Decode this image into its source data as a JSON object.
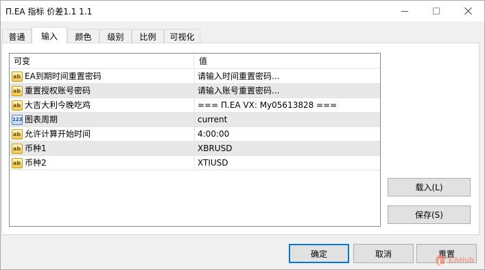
{
  "window": {
    "title": "П.EA 指标 价差1.1 1.1"
  },
  "tabs": [
    {
      "label": "普通",
      "active": false
    },
    {
      "label": "输入",
      "active": true
    },
    {
      "label": "颜色",
      "active": false
    },
    {
      "label": "级别",
      "active": false
    },
    {
      "label": "比例",
      "active": false
    },
    {
      "label": "可视化",
      "active": false
    }
  ],
  "grid": {
    "headers": {
      "variable": "可变",
      "value": "值"
    },
    "rows": [
      {
        "icon": "string-icon",
        "icon_text": "ab",
        "name": "EA到期时间重置密码",
        "value": "请输入时间重置密码..."
      },
      {
        "icon": "string-icon",
        "icon_text": "ab",
        "name": "重置授权账号密码",
        "value": "请输入账号重置密码..."
      },
      {
        "icon": "string-icon",
        "icon_text": "ab",
        "name": "大吉大利今晚吃鸡",
        "value": "=== П.EA VX:  My05613828 ==="
      },
      {
        "icon": "number-icon",
        "icon_text": "123",
        "name": "图表周期",
        "value": "current"
      },
      {
        "icon": "string-icon",
        "icon_text": "ab",
        "name": "允许计算开始时间",
        "value": "4:00:00"
      },
      {
        "icon": "string-icon",
        "icon_text": "ab",
        "name": "币种1",
        "value": "XBRUSD"
      },
      {
        "icon": "string-icon",
        "icon_text": "ab",
        "name": "币种2",
        "value": "XTIUSD"
      }
    ]
  },
  "side_buttons": {
    "load": "载入(L)",
    "save": "保存(S)"
  },
  "footer_buttons": {
    "ok": "确定",
    "cancel": "取消",
    "reset": "重置"
  },
  "watermark": {
    "text": "EAHub"
  },
  "colors": {
    "accent": "#0078d7",
    "alt_row": "#e8e8e8",
    "watermark": "#f08c74"
  }
}
